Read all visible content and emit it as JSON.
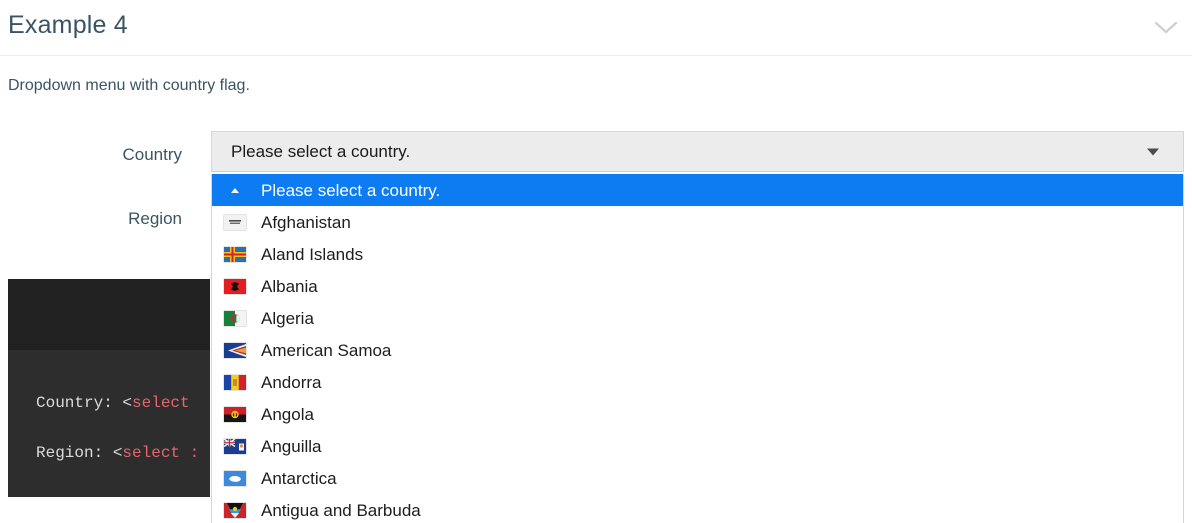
{
  "header": {
    "title": "Example 4",
    "collapse_icon": "chevron-down-icon"
  },
  "description": "Dropdown menu with country flag.",
  "form": {
    "labels": {
      "country": "Country",
      "region": "Region"
    }
  },
  "select": {
    "value": "Please select a country.",
    "placeholder": "Please select a country.",
    "arrow_icon": "triangle-down-icon",
    "expanded": true,
    "highlight_color": "#0d7cf2",
    "background_color": "#ececec"
  },
  "dropdown": {
    "options": [
      {
        "label": "Please select a country.",
        "icon": "caret-up-icon",
        "selected": true
      },
      {
        "label": "Afghanistan",
        "icon": "flag-af",
        "selected": false
      },
      {
        "label": "Aland Islands",
        "icon": "flag-ax",
        "selected": false
      },
      {
        "label": "Albania",
        "icon": "flag-al",
        "selected": false
      },
      {
        "label": "Algeria",
        "icon": "flag-dz",
        "selected": false
      },
      {
        "label": "American Samoa",
        "icon": "flag-as",
        "selected": false
      },
      {
        "label": "Andorra",
        "icon": "flag-ad",
        "selected": false
      },
      {
        "label": "Angola",
        "icon": "flag-ao",
        "selected": false
      },
      {
        "label": "Anguilla",
        "icon": "flag-ai",
        "selected": false
      },
      {
        "label": "Antarctica",
        "icon": "flag-aq",
        "selected": false
      },
      {
        "label": "Antigua and Barbuda",
        "icon": "flag-ag",
        "selected": false
      }
    ]
  },
  "code_block": {
    "lines": [
      {
        "prefix": "Country: ",
        "punct": "<",
        "tag": "select",
        "attr": ""
      },
      {
        "prefix": "Region: ",
        "punct": "<",
        "tag": "select",
        "attr": " :"
      }
    ]
  }
}
